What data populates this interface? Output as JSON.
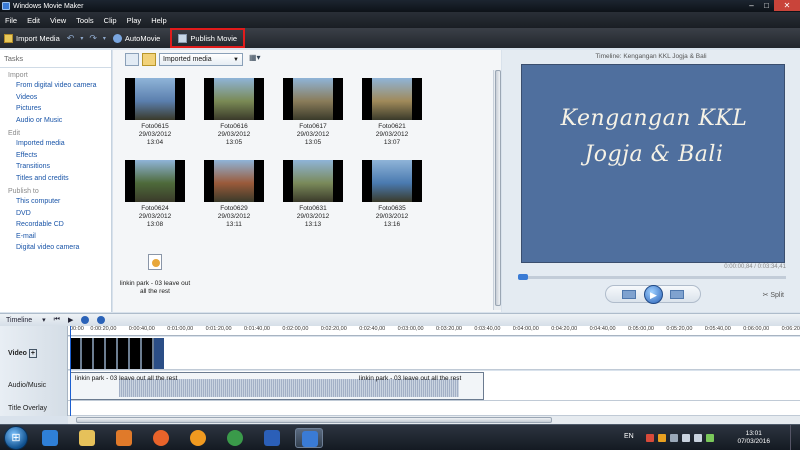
{
  "window": {
    "title": "Windows Movie Maker"
  },
  "menu": [
    "File",
    "Edit",
    "View",
    "Tools",
    "Clip",
    "Play",
    "Help"
  ],
  "toolbar": {
    "import_media": "Import Media",
    "automovie": "AutoMovie",
    "publish_movie": "Publish Movie"
  },
  "tasks": {
    "title": "Tasks",
    "sections": [
      {
        "header": "Import",
        "items": [
          "From digital video camera",
          "Videos",
          "Pictures",
          "Audio or Music"
        ]
      },
      {
        "header": "Edit",
        "items": [
          "Imported media",
          "Effects",
          "Transitions",
          "Titles and credits"
        ]
      },
      {
        "header": "Publish to",
        "items": [
          "This computer",
          "DVD",
          "Recordable CD",
          "E-mail",
          "Digital video camera"
        ]
      }
    ]
  },
  "collection": {
    "dropdown": "Imported media",
    "items": [
      {
        "name": "Foto0615 29/03/2012",
        "time": "13:04",
        "color": "#5b7fae"
      },
      {
        "name": "Foto0616 29/03/2012",
        "time": "13:05",
        "color": "#7a8a55"
      },
      {
        "name": "Foto0617 29/03/2012",
        "time": "13:05",
        "color": "#8a7c5a"
      },
      {
        "name": "Foto0621 29/03/2012",
        "time": "13:07",
        "color": "#a08a5a"
      },
      {
        "name": "Foto0624 29/03/2012",
        "time": "13:08",
        "color": "#4e6a3a"
      },
      {
        "name": "Foto0629 29/03/2012",
        "time": "13:11",
        "color": "#9a5a3a"
      },
      {
        "name": "Foto0631 29/03/2012",
        "time": "13:13",
        "color": "#7a8a5a"
      },
      {
        "name": "Foto0635 29/03/2012",
        "time": "13:16",
        "color": "#4a7ab0"
      }
    ],
    "audio": {
      "line1": "linkin park - 03 leave out",
      "line2": "all the rest"
    }
  },
  "preview": {
    "title": "Timeline: Kengangan KKL Jogja & Bali",
    "slide_line1": "Kengangan KKL",
    "slide_line2": "Jogja & Bali",
    "time": "0:00:00,84 / 0:03:34,41",
    "split": "Split"
  },
  "timeline": {
    "label": "Timeline",
    "ruler": [
      "00:00",
      "0:00:20,00",
      "0:00:40,00",
      "0:01:00,00",
      "0:01:20,00",
      "0:01:40,00",
      "0:02:00,00",
      "0:02:20,00",
      "0:02:40,00",
      "0:03:00,00",
      "0:03:20,00",
      "0:03:40,00",
      "0:04:00,00",
      "0:04:20,00",
      "0:04:40,00",
      "0:05:00,00",
      "0:05:20,00",
      "0:05:40,00",
      "0:06:00,00",
      "0:06:20,00"
    ],
    "tracks": {
      "video": "Video",
      "audio": "Audio/Music",
      "title": "Title Overlay"
    },
    "audio_clip": "linkin park - 03 leave out all the rest"
  },
  "taskbar": {
    "lang": "EN",
    "clock_time": "13:01",
    "clock_date": "07/03/2016",
    "apps": [
      {
        "name": "internet-explorer",
        "color": "#2f80d8"
      },
      {
        "name": "file-explorer",
        "color": "#e6c15a"
      },
      {
        "name": "media-player",
        "color": "#e07a2a"
      },
      {
        "name": "firefox",
        "color": "#e8632a"
      },
      {
        "name": "media-app",
        "color": "#f09a20"
      },
      {
        "name": "chrome",
        "color": "#3a9a4a"
      },
      {
        "name": "word",
        "color": "#2b5fb8"
      },
      {
        "name": "movie-maker",
        "color": "#3a7bd5"
      }
    ]
  }
}
